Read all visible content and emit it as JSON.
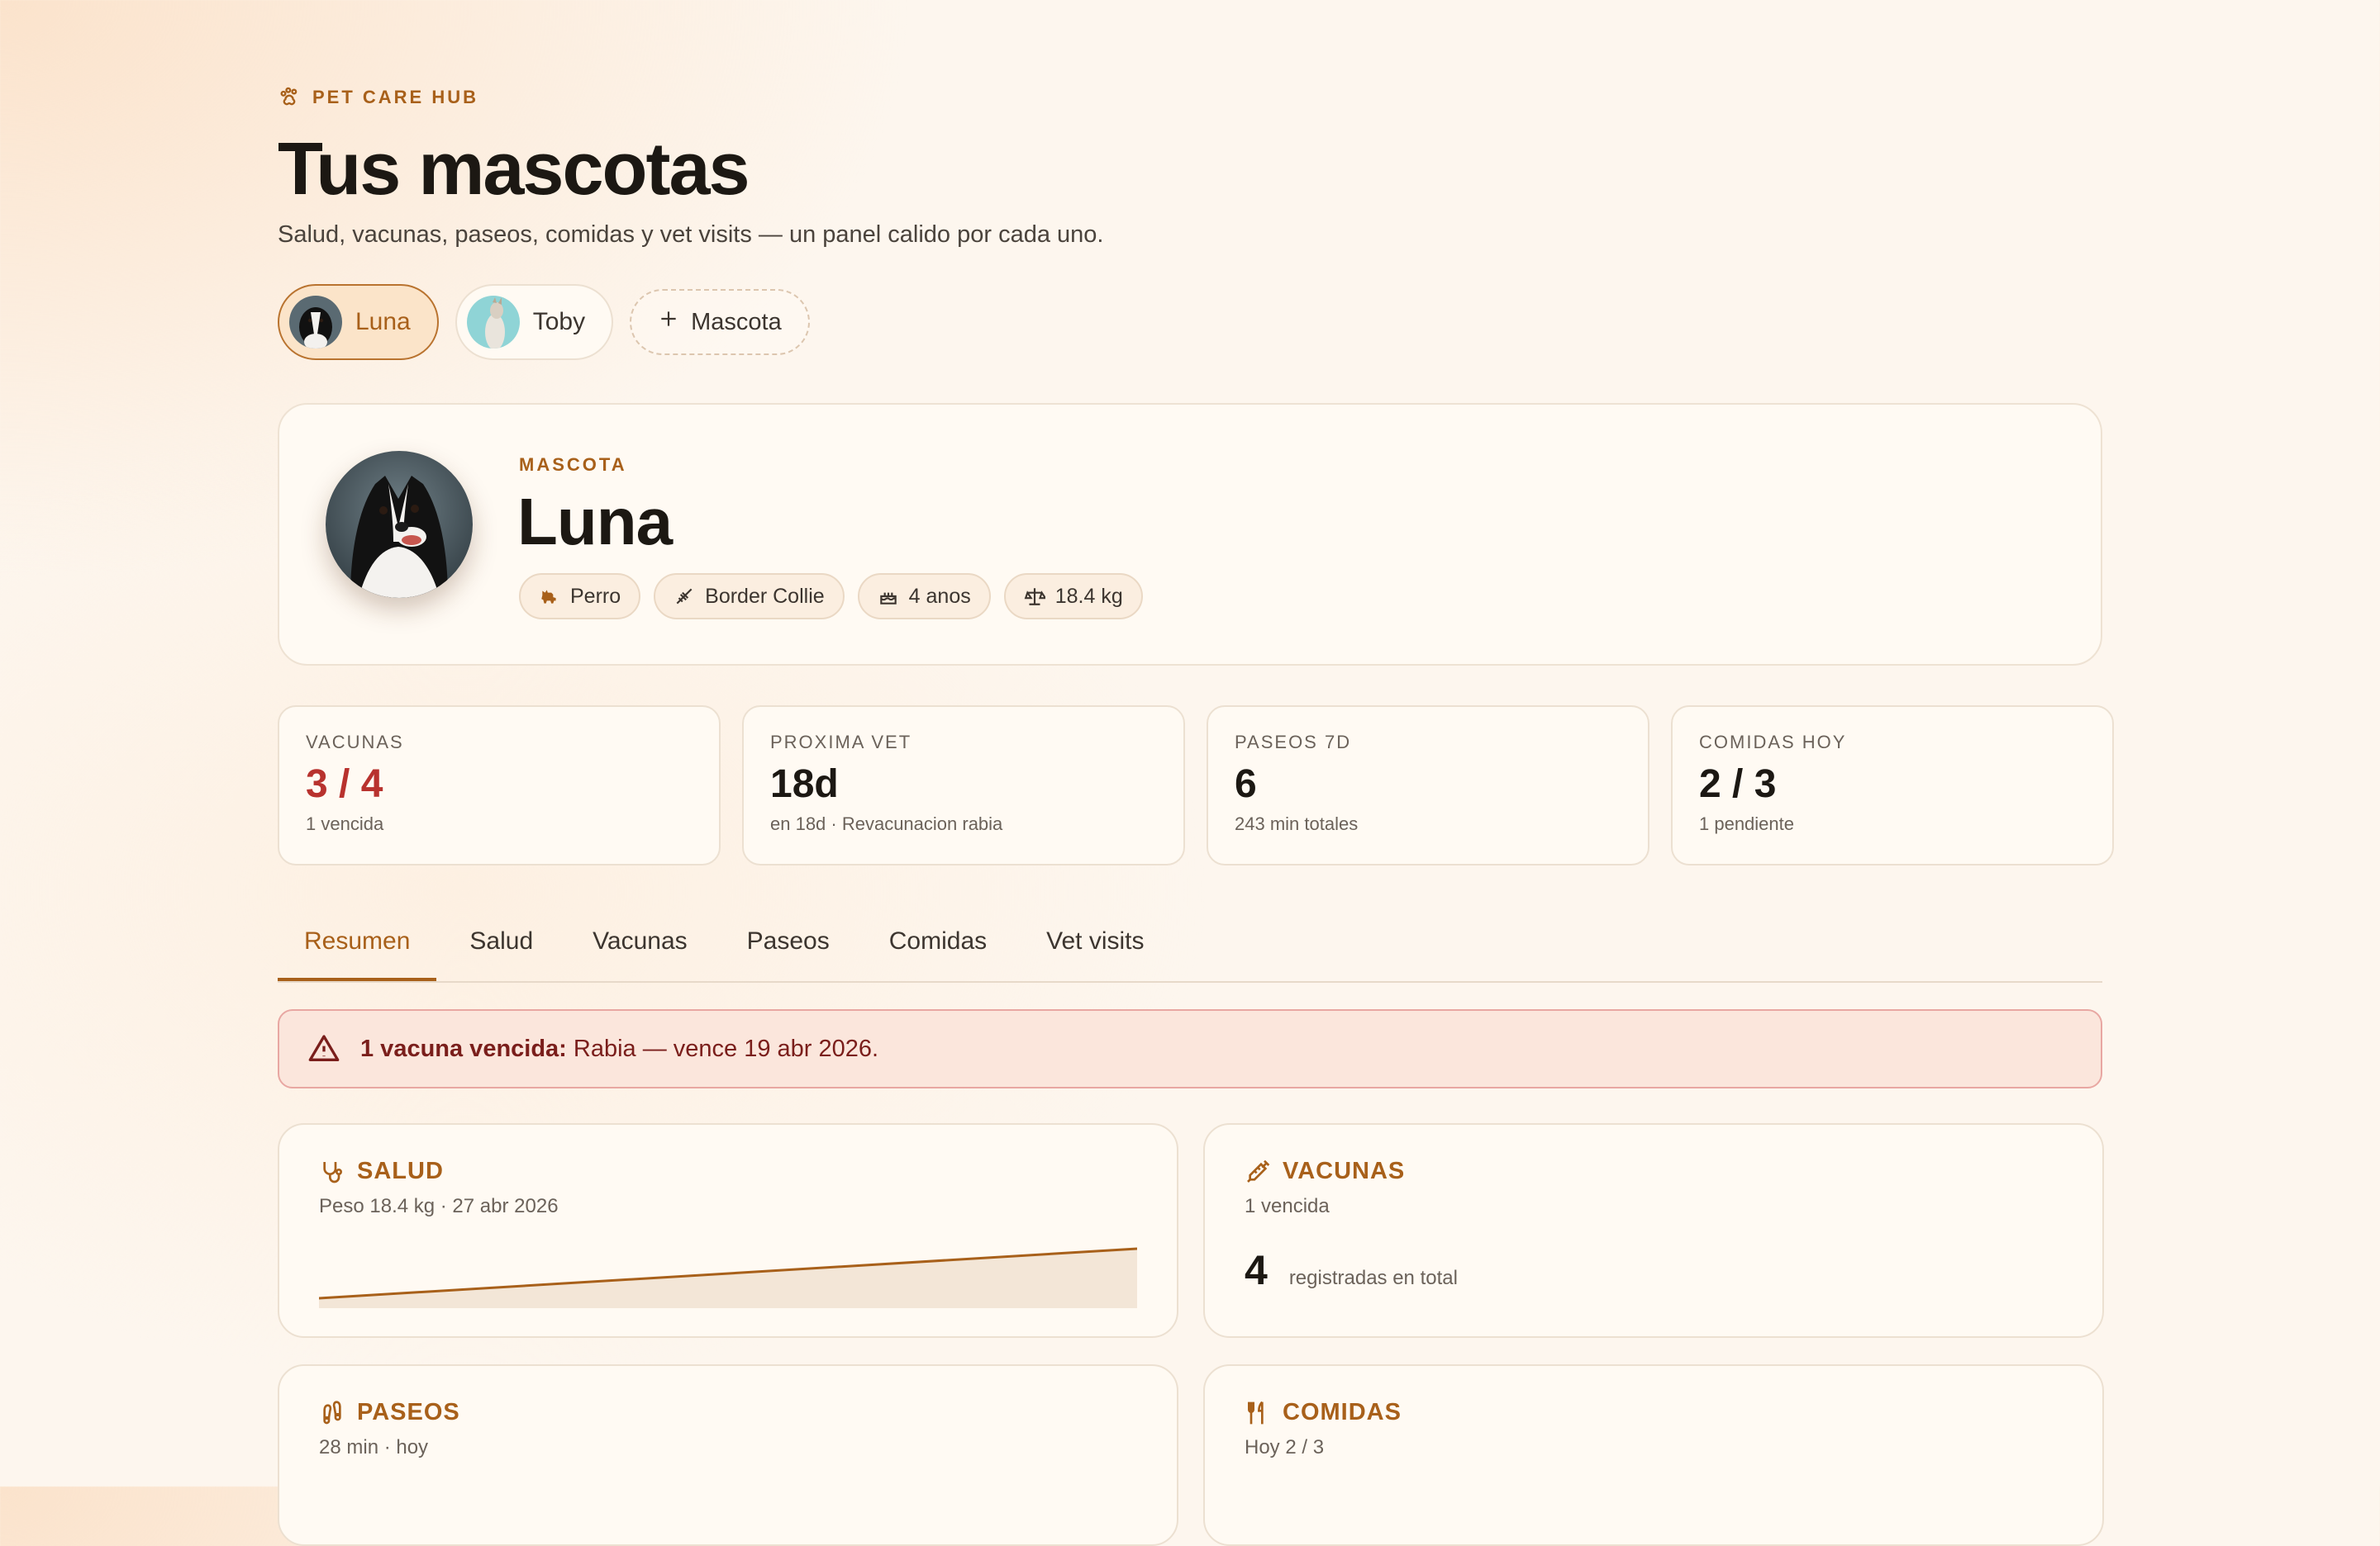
{
  "header": {
    "brand": "PET CARE HUB",
    "title": "Tus mascotas",
    "subtitle": "Salud, vacunas, paseos, comidas y vet visits — un panel calido por cada uno."
  },
  "pets": [
    {
      "name": "Luna",
      "active": true
    },
    {
      "name": "Toby",
      "active": false
    }
  ],
  "add_pet_label": "Mascota",
  "profile": {
    "tag": "MASCOTA",
    "name": "Luna",
    "species": "Perro",
    "breed": "Border Collie",
    "age": "4 anos",
    "weight": "18.4 kg"
  },
  "stats": [
    {
      "label": "VACUNAS",
      "value": "3 / 4",
      "sub": "1 vencida",
      "alert": true
    },
    {
      "label": "PROXIMA VET",
      "value": "18d",
      "sub": "en 18d · Revacunacion rabia"
    },
    {
      "label": "PASEOS 7D",
      "value": "6",
      "sub": "243 min totales"
    },
    {
      "label": "COMIDAS HOY",
      "value": "2 / 3",
      "sub": "1 pendiente"
    }
  ],
  "tabs": [
    "Resumen",
    "Salud",
    "Vacunas",
    "Paseos",
    "Comidas",
    "Vet visits"
  ],
  "active_tab": "Resumen",
  "alert": {
    "strong": "1 vacuna vencida:",
    "text": " Rabia — vence 19 abr 2026."
  },
  "cards": {
    "salud": {
      "title": "SALUD",
      "sub": "Peso 18.4 kg · 27 abr 2026"
    },
    "vacunas": {
      "title": "VACUNAS",
      "sub": "1 vencida",
      "count": "4",
      "count_label": "registradas en total"
    },
    "paseos": {
      "title": "PASEOS",
      "sub": "28 min · hoy"
    },
    "comidas": {
      "title": "COMIDAS",
      "sub": "Hoy 2 / 3"
    }
  },
  "colors": {
    "accent": "#a8601a",
    "alert": "#b8322e",
    "background": "#fdf6ee"
  }
}
